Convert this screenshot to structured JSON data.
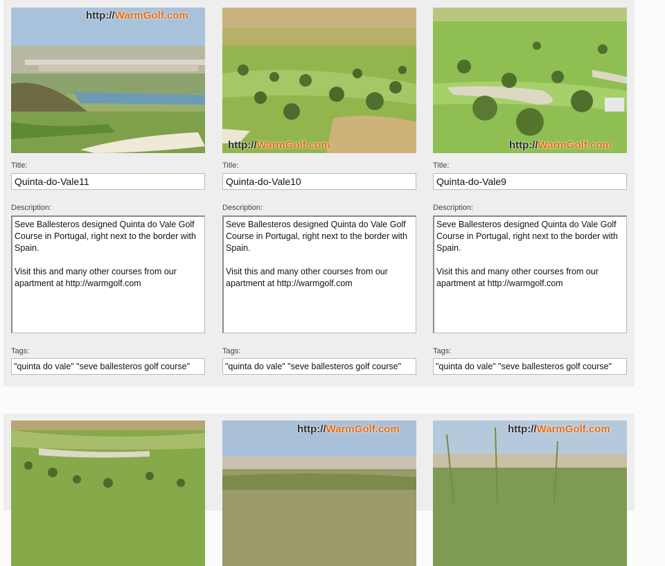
{
  "labels": {
    "title": "Title:",
    "description": "Description:",
    "tags": "Tags:"
  },
  "watermark": {
    "prefix": "http://",
    "brand": "WarmGolf.com"
  },
  "colors": {
    "panel_bg": "#eeeeee",
    "watermark_orange": "#e66a10"
  },
  "photos": [
    {
      "title": "Quinta-do-Vale11",
      "description": "Seve Ballesteros designed Quinta do Vale Golf Course in Portugal, right next to the border with Spain.\n\nVisit this and many other courses from our apartment at http://warmgolf.com",
      "tags": "\"quinta do vale\" \"seve ballesteros golf course\""
    },
    {
      "title": "Quinta-do-Vale10",
      "description": "Seve Ballesteros designed Quinta do Vale Golf Course in Portugal, right next to the border with Spain.\n\nVisit this and many other courses from our apartment at http://warmgolf.com",
      "tags": "\"quinta do vale\" \"seve ballesteros golf course\""
    },
    {
      "title": "Quinta-do-Vale9",
      "description": "Seve Ballesteros designed Quinta do Vale Golf Course in Portugal, right next to the border with Spain.\n\nVisit this and many other courses from our apartment at http://warmgolf.com",
      "tags": "\"quinta do vale\" \"seve ballesteros golf course\""
    }
  ]
}
